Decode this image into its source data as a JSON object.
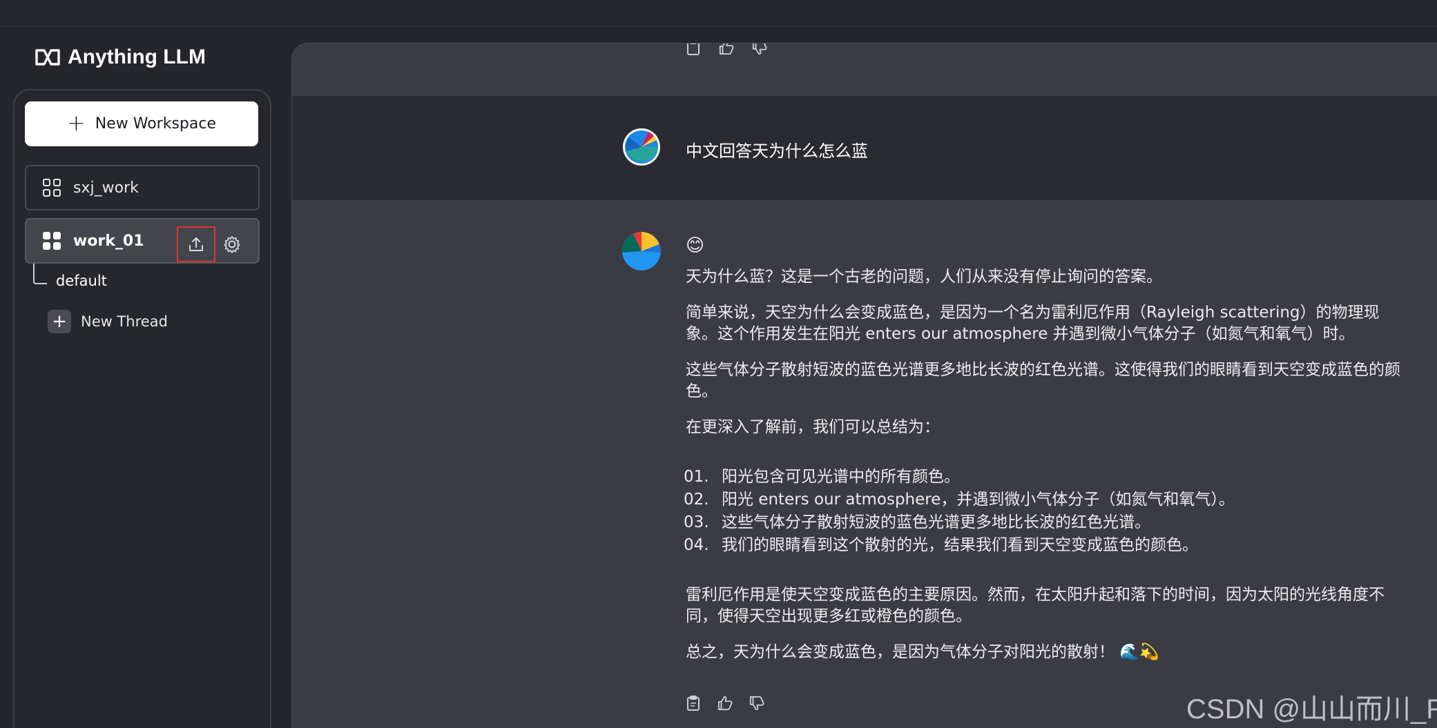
{
  "app": {
    "logo_text": "Anything LLM"
  },
  "sidebar": {
    "new_workspace_label": "New Workspace",
    "workspaces": [
      {
        "name": "sxj_work",
        "active": false
      },
      {
        "name": "work_01",
        "active": true
      }
    ],
    "threads": [
      {
        "name": "default"
      }
    ],
    "new_thread_label": "New Thread"
  },
  "chat": {
    "user_message": "中文回答天为什么怎么蓝",
    "assistant": {
      "emoji": "😊",
      "paragraphs": [
        "天为什么蓝？这是一个古老的问题，人们从来没有停止询问的答案。",
        "简单来说，天空为什么会变成蓝色，是因为一个名为雷利厄作用（Rayleigh scattering）的物理现象。这个作用发生在阳光 enters our atmosphere 并遇到微小气体分子（如氮气和氧气）时。",
        "这些气体分子散射短波的蓝色光谱更多地比长波的红色光谱。这使得我们的眼睛看到天空变成蓝色的颜色。",
        "在更深入了解前，我们可以总结为："
      ],
      "list": [
        {
          "num": "01.",
          "text": "阳光包含可见光谱中的所有颜色。"
        },
        {
          "num": "02.",
          "text": "阳光 enters our atmosphere，并遇到微小气体分子（如氮气和氧气）。"
        },
        {
          "num": "03.",
          "text": "这些气体分子散射短波的蓝色光谱更多地比长波的红色光谱。"
        },
        {
          "num": "04.",
          "text": "我们的眼睛看到这个散射的光，结果我们看到天空变成蓝色的颜色。"
        }
      ],
      "closing": [
        "雷利厄作用是使天空变成蓝色的主要原因。然而，在太阳升起和落下的时间，因为太阳的光线角度不同，使得天空出现更多红或橙色的颜色。",
        "总之，天为什么会变成蓝色，是因为气体分子对阳光的散射！ 🌊💫"
      ]
    }
  },
  "watermark": "CSDN @山山而川_R",
  "colors": {
    "highlight_border": "#e0312d",
    "background": "#25262b",
    "main_panel": "#3b3c43"
  }
}
